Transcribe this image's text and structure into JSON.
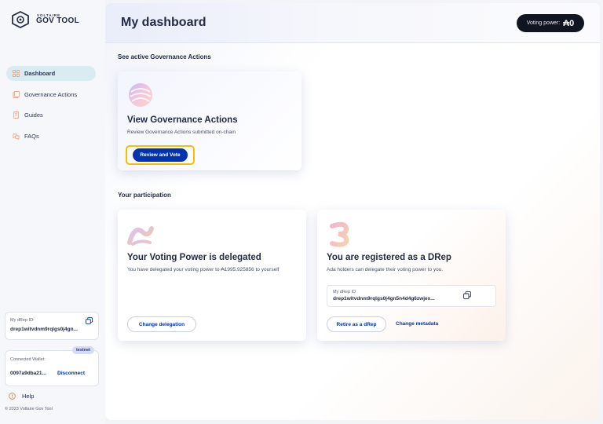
{
  "app": {
    "logo_small": "VOLTAIRE",
    "logo_big": "GOV TOOL"
  },
  "sidebar": {
    "items": [
      {
        "label": "Dashboard",
        "icon": "dashboard-icon",
        "active": true
      },
      {
        "label": "Governance Actions",
        "icon": "governance-actions-icon",
        "active": false
      },
      {
        "label": "Guides",
        "icon": "guides-icon",
        "active": false
      },
      {
        "label": "FAQs",
        "icon": "faqs-icon",
        "active": false
      }
    ],
    "drep_id_label": "My dRep ID:",
    "drep_id_value": "drep1witvdnm9rqlgs0j4gn...",
    "wallet_badge": "testnet",
    "wallet_label": "Connected Wallet:",
    "wallet_value": "0097a9dba21...",
    "disconnect_label": "Disconnect",
    "help_label": "Help",
    "copyright": "© 2023 Voltaire Gov Tool"
  },
  "header": {
    "title": "My dashboard",
    "voting_power_label": "Voting power:",
    "voting_power_value": "₳0"
  },
  "sections": {
    "active_ga": "See active Governance Actions",
    "participation": "Your participation"
  },
  "ga_card": {
    "title": "View Governance Actions",
    "description": "Review Governance Actions submitted on-chain",
    "button_label": "Review and Vote"
  },
  "voting_power_card": {
    "title": "Your Voting Power is delegated",
    "description": "You have delegated your voting power to ₳1995.925856 to yourself",
    "button_label": "Change delegation"
  },
  "drep_card": {
    "title": "You are registered as a DRep",
    "description": "Ada holders can delegate their voting power to you.",
    "drep_id_label": "My dRep ID",
    "drep_id_value": "drep1witvdnm9rqlgs0j4gn5n4d4g6zwjex...",
    "retire_label": "Retire as a dRep",
    "change_metadata_label": "Change metadata"
  },
  "colors": {
    "primary": "#0033ad",
    "highlight": "#f5c000",
    "nav_active_bg": "#d8ecf1",
    "pill_bg": "#111521"
  }
}
